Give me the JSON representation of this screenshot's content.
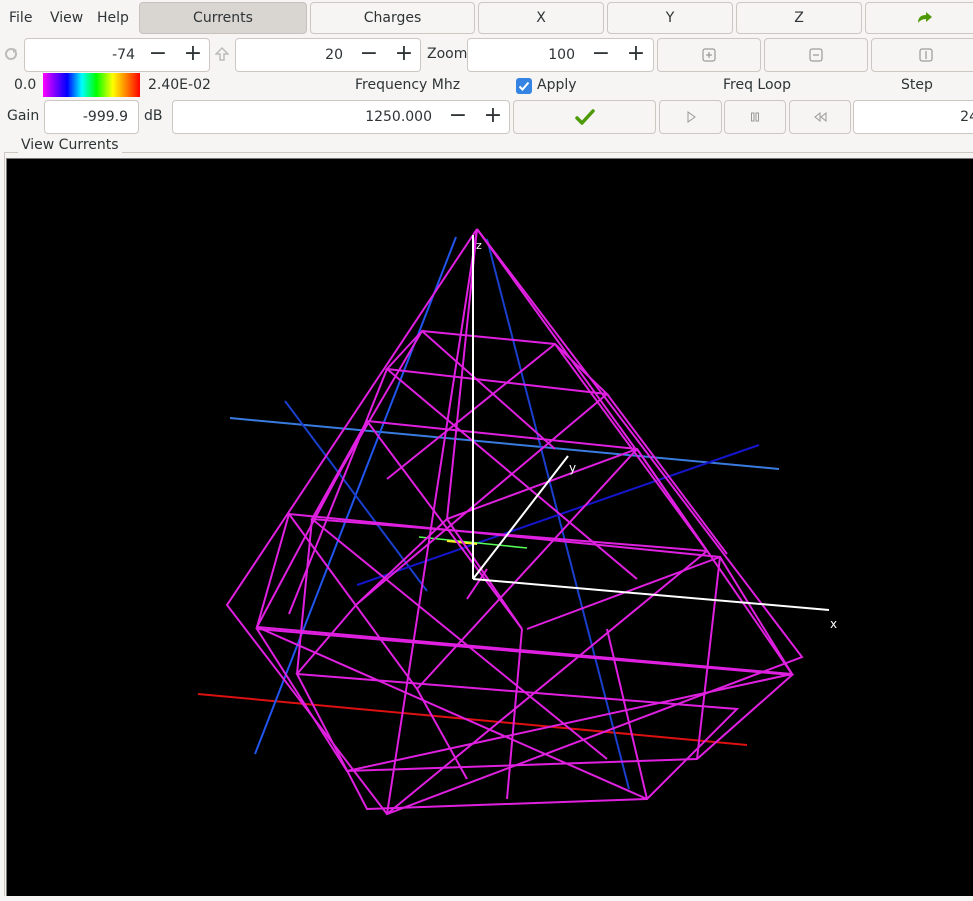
{
  "menu": {
    "file": "File",
    "view": "View",
    "help": "Help"
  },
  "toolbar": {
    "currents": "Currents",
    "charges": "Charges",
    "x": "X",
    "y": "Y",
    "z": "Z"
  },
  "rotate": {
    "value": "-74"
  },
  "incline": {
    "value": "20"
  },
  "zoom": {
    "label": "Zoom",
    "value": "100"
  },
  "scale": {
    "min": "0.0",
    "max": "2.40E-02"
  },
  "frequency": {
    "label": "Frequency Mhz",
    "value": "1250.000"
  },
  "apply": {
    "label": "Apply",
    "checked": true
  },
  "freq_loop": {
    "label": "Freq Loop"
  },
  "step": {
    "label": "Step",
    "value": "24"
  },
  "gain": {
    "label": "Gain",
    "value": "-999.9",
    "unit": "dB"
  },
  "viewport": {
    "frame_title": "View Currents",
    "axis_x": "x",
    "axis_y": "y",
    "axis_z": "z",
    "wire_color": "#e020e0"
  }
}
